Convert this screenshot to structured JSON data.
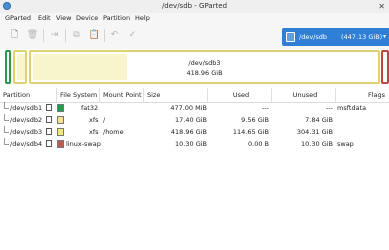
{
  "window": {
    "title": "/dev/sdb - GParted",
    "close_glyph": "✕"
  },
  "menu": [
    "GParted",
    "Edit",
    "View",
    "Device",
    "Partition",
    "Help"
  ],
  "toolbar": {
    "buttons": [
      {
        "name": "new-partition",
        "icon": "new-icon",
        "glyph": "🗋",
        "enabled": true
      },
      {
        "name": "delete-partition",
        "icon": "delete-icon",
        "glyph": "🗑",
        "enabled": false
      },
      {
        "name": "resize-move",
        "icon": "resize-icon",
        "glyph": "⇥",
        "enabled": false
      },
      {
        "name": "copy",
        "icon": "copy-icon",
        "glyph": "⧉",
        "enabled": false
      },
      {
        "name": "paste",
        "icon": "paste-icon",
        "glyph": "📋",
        "enabled": false
      },
      {
        "name": "undo",
        "icon": "undo-icon",
        "glyph": "↶",
        "enabled": false
      },
      {
        "name": "apply",
        "icon": "apply-icon",
        "glyph": "✓",
        "enabled": false
      }
    ]
  },
  "device_selector": {
    "device": "/dev/sdb",
    "size": "(447.13 GiB)",
    "caret": "▾"
  },
  "disk_map": {
    "selected": {
      "name": "/dev/sdb3",
      "size": "418.96 GiB"
    },
    "colors": {
      "fat32": "#2a9a49",
      "xfs": "#e0d36f",
      "linux_swap": "#b84a43",
      "used": "#f8f5cc"
    }
  },
  "table": {
    "headers": [
      "Partition",
      "File System",
      "Mount Point",
      "Size",
      "Used",
      "Unused",
      "Flags"
    ],
    "rows": [
      {
        "partition": "/dev/sdb1",
        "fs": "fat32",
        "fs_color": "#2a9a49",
        "mount": "",
        "size": "477.00 MiB",
        "used": "---",
        "unused": "---",
        "flags": "msftdata"
      },
      {
        "partition": "/dev/sdb2",
        "fs": "xfs",
        "fs_color": "#f1e48a",
        "mount": "/",
        "size": "17.40 GiB",
        "used": "9.56 GiB",
        "unused": "7.84 GiB",
        "flags": ""
      },
      {
        "partition": "/dev/sdb3",
        "fs": "xfs",
        "fs_color": "#f1e48a",
        "mount": "/home",
        "size": "418.96 GiB",
        "used": "114.65 GiB",
        "unused": "304.31 GiB",
        "flags": ""
      },
      {
        "partition": "/dev/sdb4",
        "fs": "linux-swap",
        "fs_color": "#c0594f",
        "mount": "",
        "size": "10.30 GiB",
        "used": "0.00 B",
        "unused": "10.30 GiB",
        "flags": "swap"
      }
    ]
  }
}
